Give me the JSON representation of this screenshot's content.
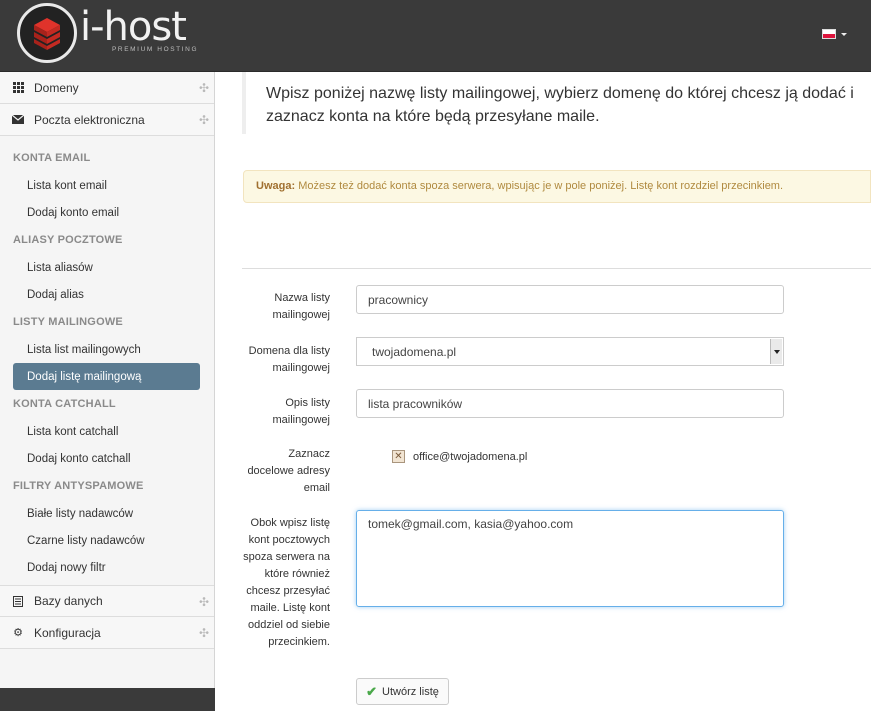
{
  "header": {
    "logo_text": "i-host",
    "logo_sub": "PREMIUM HOSTING",
    "language": "pl-flag-icon"
  },
  "sidebar": {
    "top_items": [
      {
        "label": "Domeny",
        "icon": "grid-icon"
      },
      {
        "label": "Poczta elektroniczna",
        "icon": "envelope-icon"
      }
    ],
    "sections": [
      {
        "title": "KONTA EMAIL",
        "links": [
          "Lista kont email",
          "Dodaj konto email"
        ]
      },
      {
        "title": "ALIASY POCZTOWE",
        "links": [
          "Lista aliasów",
          "Dodaj alias"
        ]
      },
      {
        "title": "LISTY MAILINGOWE",
        "links": [
          "Lista list mailingowych",
          "Dodaj listę mailingową"
        ]
      },
      {
        "title": "KONTA CATCHALL",
        "links": [
          "Lista kont catchall",
          "Dodaj konto catchall"
        ]
      },
      {
        "title": "FILTRY ANTYSPAMOWE",
        "links": [
          "Białe listy nadawców",
          "Czarne listy nadawców",
          "Dodaj nowy filtr"
        ]
      }
    ],
    "active_link": "Dodaj listę mailingową",
    "bottom_items": [
      {
        "label": "Bazy danych",
        "icon": "list-icon"
      },
      {
        "label": "Konfiguracja",
        "icon": "gear-icon"
      }
    ]
  },
  "main": {
    "intro": "Wpisz poniżej nazwę listy mailingowej, wybierz domenę do której chcesz ją dodać i zaznacz konta na które będą przesyłane maile.",
    "alert_strong": "Uwaga:",
    "alert_text": "Możesz też dodać konta spoza serwera, wpisując je w pole poniżej. Listę kont rozdziel przecinkiem.",
    "form": {
      "name_label": "Nazwa listy mailingowej",
      "name_value": "pracownicy",
      "domain_label": "Domena dla listy mailingowej",
      "domain_value": "twojadomena.pl",
      "desc_label": "Opis listy mailingowej",
      "desc_value": "lista pracowników",
      "targets_label": "Zaznacz docelowe adresy email",
      "target_option": "office@twojadomena.pl",
      "external_label": "Obok wpisz listę kont pocztowych spoza serwera na które również chcesz przesyłać maile. Listę kont oddziel od siebie przecinkiem.",
      "external_value": "tomek@gmail.com, kasia@yahoo.com",
      "submit_label": "Utwórz listę"
    }
  }
}
